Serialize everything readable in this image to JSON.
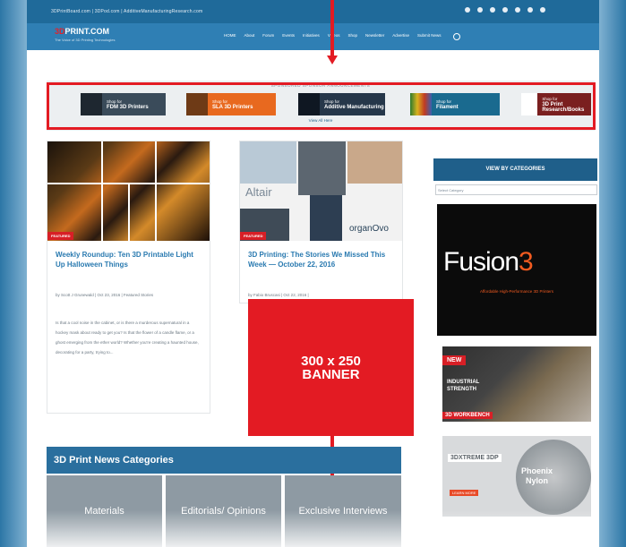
{
  "topbar": {
    "links": "3DPrintBoard.com | 3DPod.com | AdditiveManufacturingResearch.com"
  },
  "header": {
    "logo_prefix": "3D",
    "logo_main": "PRINT.COM",
    "tagline": "The Voice of 3D Printing Technologies",
    "nav": [
      "HOME",
      "About",
      "Forum",
      "Events",
      "Initiatives",
      "Videos",
      "Shop",
      "Newsletter",
      "Advertise",
      "Submit News"
    ]
  },
  "sponsor": {
    "title": "SPONSORED SPONSOR ANNOUNCEMENTS",
    "ads": [
      {
        "small": "Shop for",
        "big": "FDM 3D Printers"
      },
      {
        "small": "Shop for",
        "big": "SLA 3D Printers"
      },
      {
        "small": "Shop for",
        "big": "Additive Manufacturing"
      },
      {
        "small": "Shop for",
        "big": "Filament"
      },
      {
        "small": "Shop for",
        "big": "3D Print Research/Books"
      }
    ],
    "view_all": "View All Here"
  },
  "cards": [
    {
      "badge": "FEATURED",
      "title": "Weekly Roundup: Ten 3D Printable Light Up Halloween Things",
      "meta": "by Scott J Grunewald | Oct 23, 2016 | Featured Stories",
      "excerpt": "Is that a cool noise in the cabinet, or is there a murderous supernatural in a hockey mask about ready to get you? Is that the flower of a candle flame, or a ghost emerging from the ether world? Whether you're creating a haunted house, decorating for a party, trying to..."
    },
    {
      "badge": "FEATURED",
      "title": "3D Printing: The Stories We Missed This Week — October 22, 2016",
      "meta": "by Fabio Bruscasi | Oct 22, 2016 |",
      "logo_altair": "Altair",
      "logo_organovo": "organOvo"
    }
  ],
  "banner": {
    "line1": "300 x 250",
    "line2": "BANNER"
  },
  "sidebar": {
    "title": "VIEW BY CATEGORIES",
    "select_placeholder": "Select Category",
    "fusion_main": "Fusion",
    "fusion_num": "3",
    "fusion_tag": "Affordable High-Performance 3D Printers",
    "wb_new": "NEW",
    "wb_line1": "INDUSTRIAL",
    "wb_line2": "STRENGTH",
    "wb_brand": "3D WORKBENCH",
    "phoenix_brand": "3DXTREME 3DP",
    "phoenix_title1": "Phoenix",
    "phoenix_title2": "Nylon",
    "phoenix_cta": "LEARN MORE"
  },
  "categories": {
    "title": "3D Print News Categories",
    "tiles": [
      "Materials",
      "Editorials/ Opinions",
      "Exclusive Interviews"
    ]
  },
  "colors": {
    "accent": "#e31b23",
    "nav": "#2f7fb4",
    "link": "#2a7ab0"
  }
}
